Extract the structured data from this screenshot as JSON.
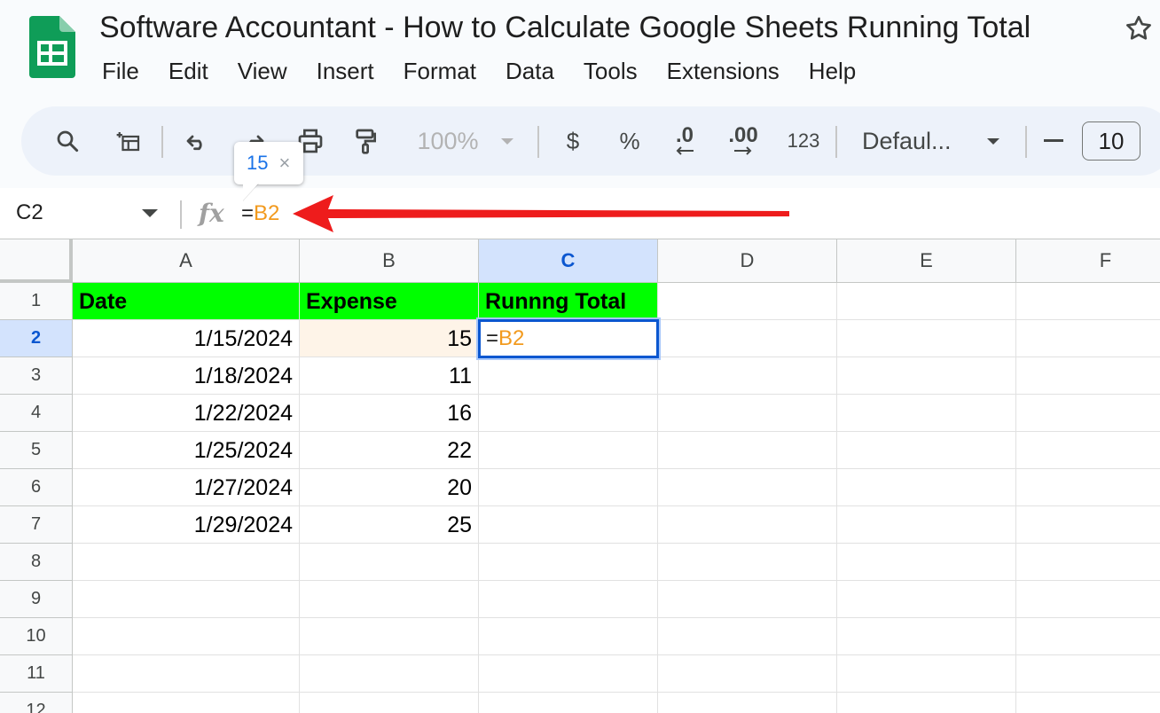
{
  "app": {
    "title": "Software Accountant - How to Calculate Google Sheets Running Total",
    "menu": [
      "File",
      "Edit",
      "View",
      "Insert",
      "Format",
      "Data",
      "Tools",
      "Extensions",
      "Help"
    ],
    "colors": {
      "brand_green": "#0f9d58",
      "selection_blue": "#0b57d0",
      "header_fill": "#00ff00",
      "ref_orange": "#f29a1e"
    }
  },
  "toolbar": {
    "icons": [
      "search-icon",
      "apply-table-icon",
      "undo-icon",
      "redo-icon",
      "print-icon",
      "paint-format-icon"
    ],
    "zoom": "100%",
    "currency": "$",
    "percent": "%",
    "decrease_decimal": ".0",
    "increase_decimal": ".00",
    "number_format": "123",
    "font": "Defaul...",
    "font_size": "10"
  },
  "tooltip": {
    "value": "15",
    "close": "×"
  },
  "formula_bar": {
    "namebox": "C2",
    "fx": "fx",
    "equals": "=",
    "reference": "B2"
  },
  "grid": {
    "columns": [
      "A",
      "B",
      "C",
      "D",
      "E",
      "F"
    ],
    "rows": [
      "1",
      "2",
      "3",
      "4",
      "5",
      "6",
      "7",
      "8",
      "9",
      "10",
      "11",
      "12"
    ],
    "headers": {
      "a": "Date",
      "b": "Expense",
      "c": "Runnng Total"
    },
    "data": [
      {
        "date": "1/15/2024",
        "expense": "15"
      },
      {
        "date": "1/18/2024",
        "expense": "11"
      },
      {
        "date": "1/22/2024",
        "expense": "16"
      },
      {
        "date": "1/25/2024",
        "expense": "22"
      },
      {
        "date": "1/27/2024",
        "expense": "20"
      },
      {
        "date": "1/29/2024",
        "expense": "25"
      }
    ],
    "active_cell": {
      "equals": "=",
      "reference": "B2"
    }
  }
}
